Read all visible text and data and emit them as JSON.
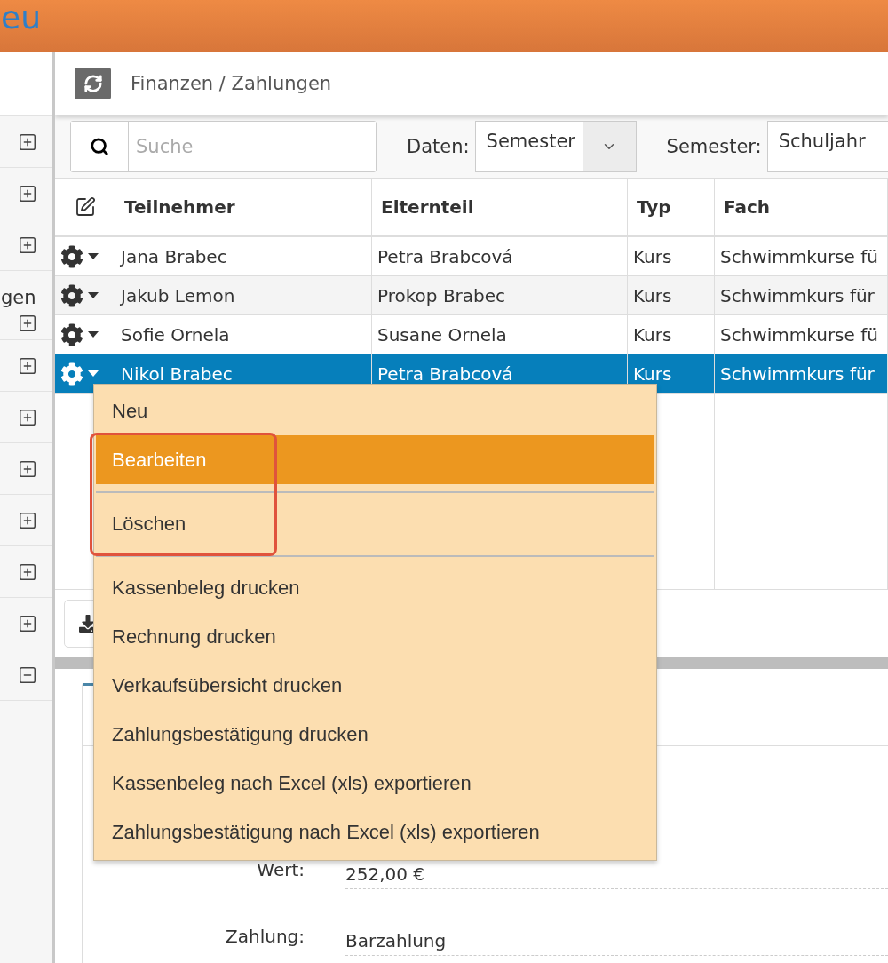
{
  "header": {
    "title": "eu"
  },
  "sidebar": {
    "items": [
      {
        "expanded": false
      },
      {
        "expanded": false
      },
      {
        "expanded": false
      },
      {
        "label": "gen",
        "expanded": false
      },
      {
        "expanded": false
      },
      {
        "expanded": false
      },
      {
        "expanded": false
      },
      {
        "expanded": false
      },
      {
        "expanded": false
      },
      {
        "expanded": false
      },
      {
        "expanded": true
      }
    ]
  },
  "breadcrumb": "Finanzen / Zahlungen",
  "toolbar": {
    "search": {
      "placeholder": "Suche"
    },
    "filters": [
      {
        "label": "Daten:",
        "value": "Semester"
      },
      {
        "label": "Semester:",
        "value": "Schuljahr"
      }
    ]
  },
  "table": {
    "columns": [
      "Teilnehmer",
      "Elternteil",
      "Typ",
      "Fach"
    ],
    "rows": [
      {
        "cells": [
          "Jana Brabec",
          "Petra Brabcová",
          "Kurs",
          "Schwimmkurse fü"
        ],
        "selected": false
      },
      {
        "cells": [
          "Jakub Lemon",
          "Prokop Brabec",
          "Kurs",
          "Schwimmkurs für"
        ],
        "selected": false
      },
      {
        "cells": [
          "Sofie Ornela",
          "Susane Ornela",
          "Kurs",
          "Schwimmkurse fü"
        ],
        "selected": false
      },
      {
        "cells": [
          "Nikol Brabec",
          "Petra Brabcová",
          "Kurs",
          "Schwimmkurs für"
        ],
        "selected": true
      }
    ]
  },
  "context_menu": {
    "items": [
      {
        "kind": "item",
        "label": "Neu",
        "selected": false
      },
      {
        "kind": "item",
        "label": "Bearbeiten",
        "selected": true
      },
      {
        "kind": "separator"
      },
      {
        "kind": "item",
        "label": "Löschen",
        "selected": false
      },
      {
        "kind": "separator"
      },
      {
        "kind": "item",
        "label": "Kassenbeleg drucken",
        "selected": false
      },
      {
        "kind": "item",
        "label": "Rechnung drucken",
        "selected": false
      },
      {
        "kind": "item",
        "label": "Verkaufsübersicht drucken",
        "selected": false
      },
      {
        "kind": "item",
        "label": "Zahlungsbestätigung drucken",
        "selected": false
      },
      {
        "kind": "item",
        "label": "Kassenbeleg nach Excel (xls) exportieren",
        "selected": false
      },
      {
        "kind": "item",
        "label": "Zahlungsbestätigung nach Excel (xls) exportieren",
        "selected": false
      }
    ]
  },
  "detail": {
    "fields": [
      {
        "label": "Wert:",
        "value": "252,00 €"
      },
      {
        "label": "Zahlung:",
        "value": "Barzahlung"
      }
    ]
  }
}
